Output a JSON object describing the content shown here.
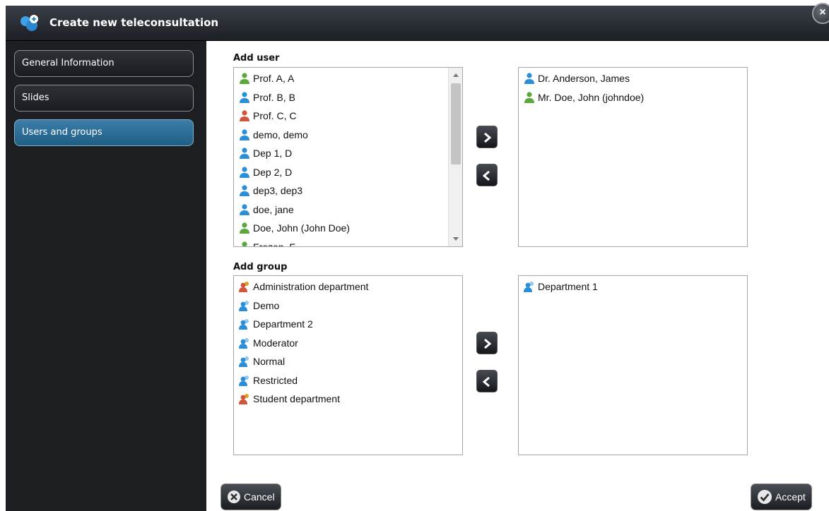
{
  "window": {
    "title": "Create new teleconsultation",
    "close_glyph": "×"
  },
  "sidebar": {
    "items": [
      {
        "label": "General Information",
        "active": false
      },
      {
        "label": "Slides",
        "active": false
      },
      {
        "label": "Users and groups",
        "active": true
      }
    ]
  },
  "users_section": {
    "label": "Add user",
    "available": [
      {
        "label": "Prof. A, A",
        "icon": "user-green-icon"
      },
      {
        "label": "Prof. B, B",
        "icon": "user-blue-icon"
      },
      {
        "label": "Prof. C, C",
        "icon": "user-red-icon"
      },
      {
        "label": "demo, demo",
        "icon": "user-blue-icon"
      },
      {
        "label": "Dep 1, D",
        "icon": "user-blue-icon"
      },
      {
        "label": "Dep 2, D",
        "icon": "user-blue-icon"
      },
      {
        "label": "dep3, dep3",
        "icon": "user-blue-icon"
      },
      {
        "label": "doe, jane",
        "icon": "user-blue-icon"
      },
      {
        "label": "Doe, John (John Doe)",
        "icon": "user-green-icon"
      },
      {
        "label": "Frozen, F",
        "icon": "user-green-icon"
      }
    ],
    "selected": [
      {
        "label": "Dr. Anderson, James",
        "icon": "user-blue-icon"
      },
      {
        "label": "Mr. Doe, John (johndoe)",
        "icon": "user-green-icon"
      }
    ]
  },
  "groups_section": {
    "label": "Add group",
    "available": [
      {
        "label": "Administration department",
        "icon": "group-red-icon"
      },
      {
        "label": "Demo",
        "icon": "group-blue-icon"
      },
      {
        "label": "Department 2",
        "icon": "group-blue-icon"
      },
      {
        "label": "Moderator",
        "icon": "group-blue-icon"
      },
      {
        "label": "Normal",
        "icon": "group-blue-icon"
      },
      {
        "label": "Restricted",
        "icon": "group-blue-icon"
      },
      {
        "label": "Student department",
        "icon": "group-red-icon"
      }
    ],
    "selected": [
      {
        "label": "Department 1",
        "icon": "group-blue-icon"
      }
    ]
  },
  "footer": {
    "cancel_label": "Cancel",
    "accept_label": "Accept"
  },
  "colors": {
    "user_blue": "#2a8fd8",
    "user_green": "#5aa83a",
    "user_red": "#d0553a",
    "active_nav": "#2e6f99",
    "titlebar": "#2a2e34"
  }
}
